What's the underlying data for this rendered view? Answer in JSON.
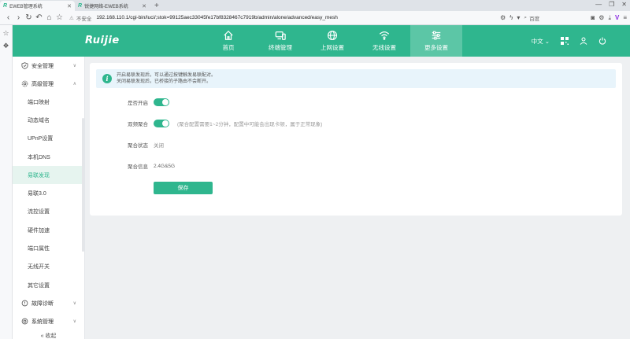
{
  "browser": {
    "tabs": [
      {
        "title": "EWEB管理系统",
        "active": true
      },
      {
        "title": "锐捷网络-EWEB系统",
        "active": false
      }
    ],
    "new_tab": "+",
    "insecure_label": "不安全",
    "url": "192.168.110.1/cgi-bin/luci/;stok=99125aec33045fe17bf8328467c7919b/admin/alone/advanced/easy_mesh",
    "search_placeholder": "百度",
    "window_controls": [
      "—",
      "❐",
      "✕"
    ]
  },
  "app": {
    "logo": "Ruijie",
    "brand_color": "#2fb68e",
    "nav": [
      {
        "label": "首页",
        "icon": "home-icon",
        "active": false
      },
      {
        "label": "终端管理",
        "icon": "devices-icon",
        "active": false
      },
      {
        "label": "上网设置",
        "icon": "globe-icon",
        "active": false
      },
      {
        "label": "无线设置",
        "icon": "wifi-icon",
        "active": false
      },
      {
        "label": "更多设置",
        "icon": "sliders-icon",
        "active": true
      }
    ],
    "language": "中文"
  },
  "sidebar": {
    "groups": [
      {
        "label": "安全管理",
        "icon": "shield-icon"
      },
      {
        "label": "高级管理",
        "icon": "settings-icon"
      }
    ],
    "items": [
      "端口映射",
      "动态域名",
      "UPnP设置",
      "本机DNS",
      "易联发现",
      "易联3.0",
      "流控设置",
      "硬件加速",
      "端口属性",
      "无线开关",
      "其它设置"
    ],
    "active_item": "易联发现",
    "bottom_groups": [
      {
        "label": "故障诊断",
        "icon": "diagnose-icon"
      },
      {
        "label": "系统管理",
        "icon": "system-icon"
      }
    ],
    "collapse_label": "« 收起"
  },
  "main": {
    "notice_lines": [
      "开启易联发现后，可以通过按键触发易联配对。",
      "关闭易联发现后，已桥接的子路由不会断开。"
    ],
    "fields": {
      "enable_label": "是否开启",
      "enable_on": true,
      "dual_label": "双频聚合",
      "dual_on": true,
      "dual_hint": "(聚合配置需要1~2分钟，配置中可能会出现卡顿，属于正常现象)",
      "status_label": "聚合状态",
      "status_value": "关闭",
      "info_label": "聚合信息",
      "info_value": "2.4G&5G"
    },
    "save_label": "保存"
  }
}
